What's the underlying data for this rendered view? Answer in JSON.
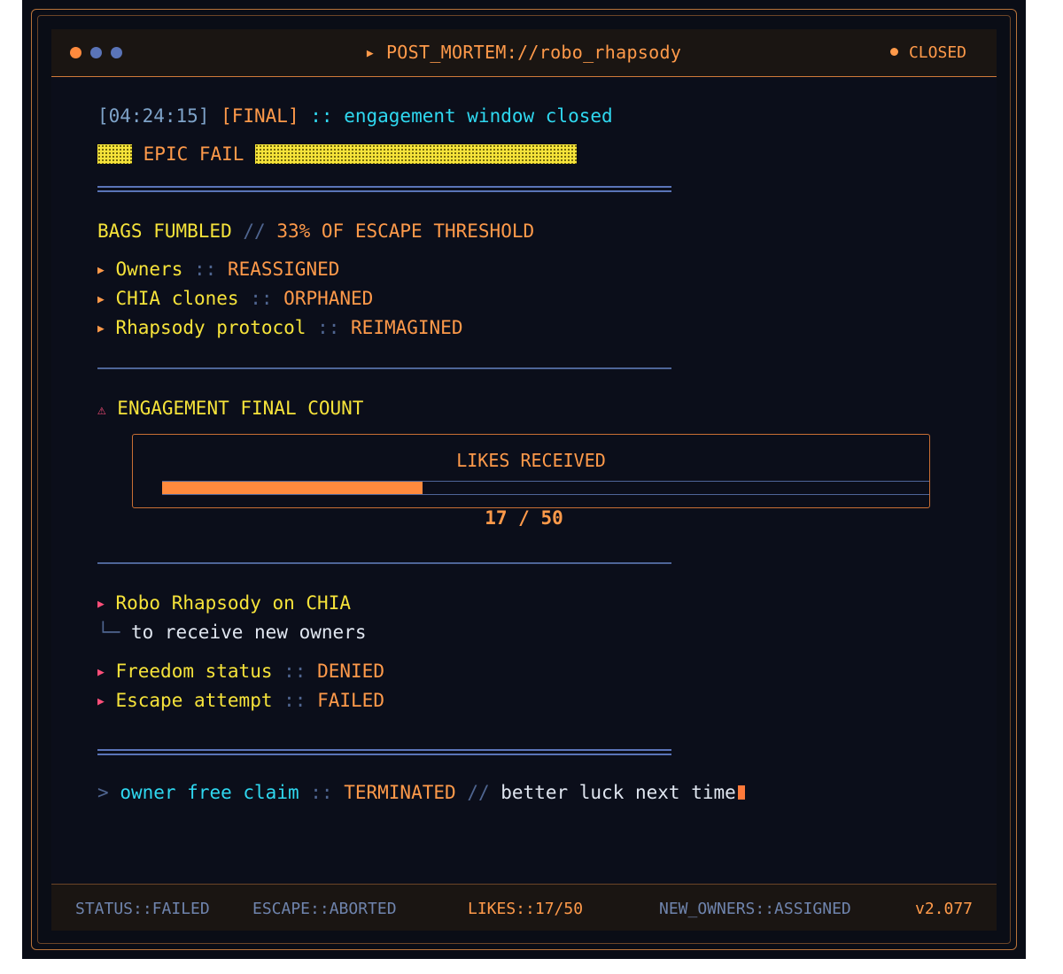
{
  "window": {
    "dot_colors": [
      "#ff8a3d",
      "#5a74b8",
      "#5a74b8"
    ],
    "title": "POST_MORTEM://robo_rhapsody",
    "state": "CLOSED"
  },
  "log": {
    "timestamp": "[04:24:15]",
    "tag": "[FINAL]",
    "sep": "::",
    "message": "engagement window closed",
    "banner": "EPIC FAIL"
  },
  "bags": {
    "heading": "BAGS FUMBLED",
    "slash": "//",
    "threshold": "33% OF ESCAPE THRESHOLD",
    "items": [
      {
        "label": "Owners",
        "sep": "::",
        "value": "REASSIGNED"
      },
      {
        "label": "CHIA clones",
        "sep": "::",
        "value": "ORPHANED"
      },
      {
        "label": "Rhapsody protocol",
        "sep": "::",
        "value": "REIMAGINED"
      }
    ]
  },
  "engagement": {
    "warn_icon": "⚠",
    "heading": "ENGAGEMENT FINAL COUNT",
    "likes_label": "LIKES RECEIVED",
    "likes_current": 17,
    "likes_total": 50,
    "likes_text": "17 / 50"
  },
  "outcome": {
    "headline": "Robo Rhapsody on CHIA",
    "branch": "└─",
    "sub": "to receive new owners",
    "items": [
      {
        "label": "Freedom status",
        "sep": "::",
        "value": "DENIED"
      },
      {
        "label": "Escape attempt",
        "sep": "::",
        "value": "FAILED"
      }
    ]
  },
  "prompt": {
    "symbol": ">",
    "command": "owner free claim",
    "sep": "::",
    "result": "TERMINATED",
    "slash": "//",
    "note": "better luck next time"
  },
  "statusbar": {
    "status": "STATUS::FAILED",
    "escape": "ESCAPE::ABORTED",
    "likes": "LIKES::17/50",
    "owners": "NEW_OWNERS::ASSIGNED",
    "version": "v2.077"
  },
  "colors": {
    "orange": "#ff9a4a",
    "cyan": "#2fd8f0",
    "yellow": "#f6e33a",
    "pink": "#ff4f7a",
    "bar_fill": "#ff8a3d",
    "background": "#0b0e1a"
  }
}
